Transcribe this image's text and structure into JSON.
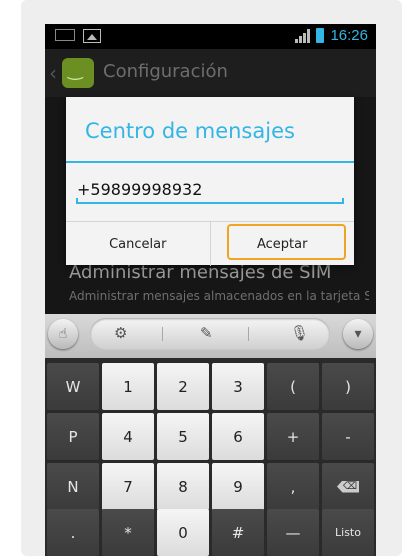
{
  "status_bar": {
    "time": "16:26",
    "accent": "#33b5e5"
  },
  "action_bar": {
    "title": "Configuración"
  },
  "background_setting": {
    "title": "Administrar mensajes de SIM",
    "subtitle": "Administrar mensajes almacenados en la tarjeta SIM"
  },
  "dialog": {
    "title": "Centro de mensajes",
    "input_value": "+59899998932",
    "cancel_label": "Cancelar",
    "ok_label": "Aceptar",
    "highlight_color": "#f0a424"
  },
  "keyboard": {
    "toolbar_icons": [
      "touch-hand-icon",
      "settings-gear-icon",
      "handwriting-icon",
      "microphone-icon",
      "chevron-down-icon"
    ],
    "rows": [
      [
        "W",
        "1",
        "2",
        "3",
        "(",
        ")"
      ],
      [
        "P",
        "4",
        "5",
        "6",
        "+",
        "-"
      ],
      [
        "N",
        "7",
        "8",
        "9",
        ",",
        "⌫"
      ],
      [
        ".",
        "*",
        "0",
        "#",
        "—",
        "Listo"
      ]
    ]
  }
}
